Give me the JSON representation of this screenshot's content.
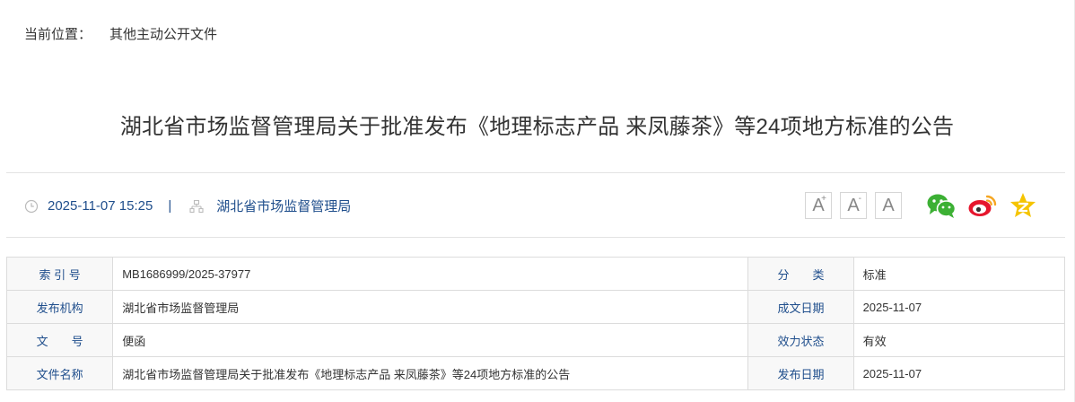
{
  "breadcrumb": {
    "label": "当前位置：",
    "current": "其他主动公开文件"
  },
  "article": {
    "title": "湖北省市场监督管理局关于批准发布《地理标志产品 来凤藤茶》等24项地方标准的公告",
    "datetime": "2025-11-07 15:25",
    "separator": "|",
    "publisher": "湖北省市场监督管理局"
  },
  "tools": {
    "font_large": "A",
    "font_large_mark": "+",
    "font_small": "A",
    "font_small_mark": "-",
    "font_reset": "A",
    "share_icons": [
      "wechat-icon",
      "weibo-icon",
      "qzone-icon"
    ],
    "colors": {
      "wechat": "#3cb034",
      "weibo": "#e6162d",
      "weibo_accent": "#f5a623",
      "qzone": "#f5c400"
    }
  },
  "info_table": {
    "rows": [
      {
        "label1": "索 引 号",
        "value1": "MB1686999/2025-37977",
        "label2": "分　　类",
        "value2": "标准"
      },
      {
        "label1": "发布机构",
        "value1": "湖北省市场监督管理局",
        "label2": "成文日期",
        "value2": "2025-11-07"
      },
      {
        "label1": "文　　号",
        "value1": "便函",
        "label2": "效力状态",
        "value2": "有效"
      },
      {
        "label1": "文件名称",
        "value1": "湖北省市场监督管理局关于批准发布《地理标志产品 来凤藤茶》等24项地方标准的公告",
        "label2": "发布日期",
        "value2": "2025-11-07"
      }
    ]
  },
  "colors": {
    "link_blue": "#1f4e8c",
    "label_bg": "#f8f8f8",
    "border": "#dcdcdc"
  }
}
